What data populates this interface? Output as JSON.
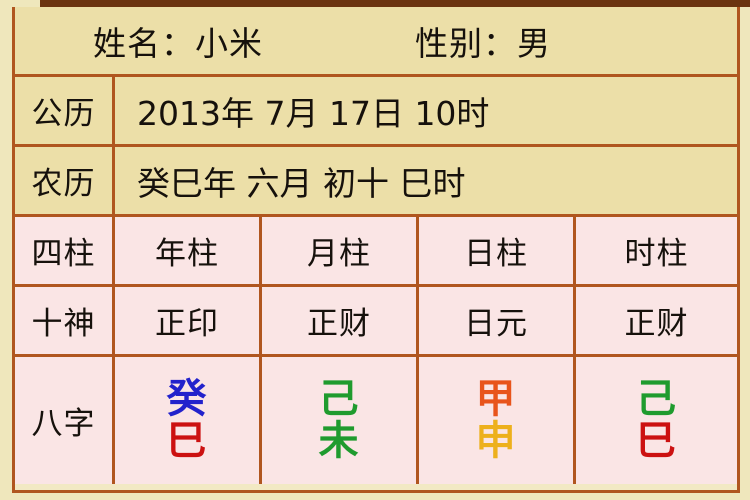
{
  "page": {
    "background_color": "#efe7bc",
    "table_border_color": "#b0561f",
    "header_bg_color": "#ecdfa8",
    "pillar_bg_color": "#fae5e5"
  },
  "header": {
    "name_text": "姓名：小米",
    "gender_text": "性别：男"
  },
  "rows": {
    "solar": {
      "label": "公历",
      "value": "2013年 7月 17日 10时"
    },
    "lunar": {
      "label": "农历",
      "value": "癸巳年 六月 初十 巳时"
    },
    "four_pillars": {
      "label": "四柱",
      "columns": [
        "年柱",
        "月柱",
        "日柱",
        "时柱"
      ]
    },
    "ten_gods": {
      "label": "十神",
      "columns": [
        "正印",
        "正财",
        "日元",
        "正财"
      ]
    },
    "bazi": {
      "label": "八字",
      "pillars": [
        {
          "stem": "癸",
          "stem_color": "#2222cc",
          "branch": "巳",
          "branch_color": "#cc1111"
        },
        {
          "stem": "己",
          "stem_color": "#1f9b2e",
          "branch": "未",
          "branch_color": "#1f9b2e"
        },
        {
          "stem": "甲",
          "stem_color": "#e8541b",
          "branch": "申",
          "branch_color": "#edb01c"
        },
        {
          "stem": "己",
          "stem_color": "#1f9b2e",
          "branch": "巳",
          "branch_color": "#cc1111"
        }
      ]
    }
  }
}
